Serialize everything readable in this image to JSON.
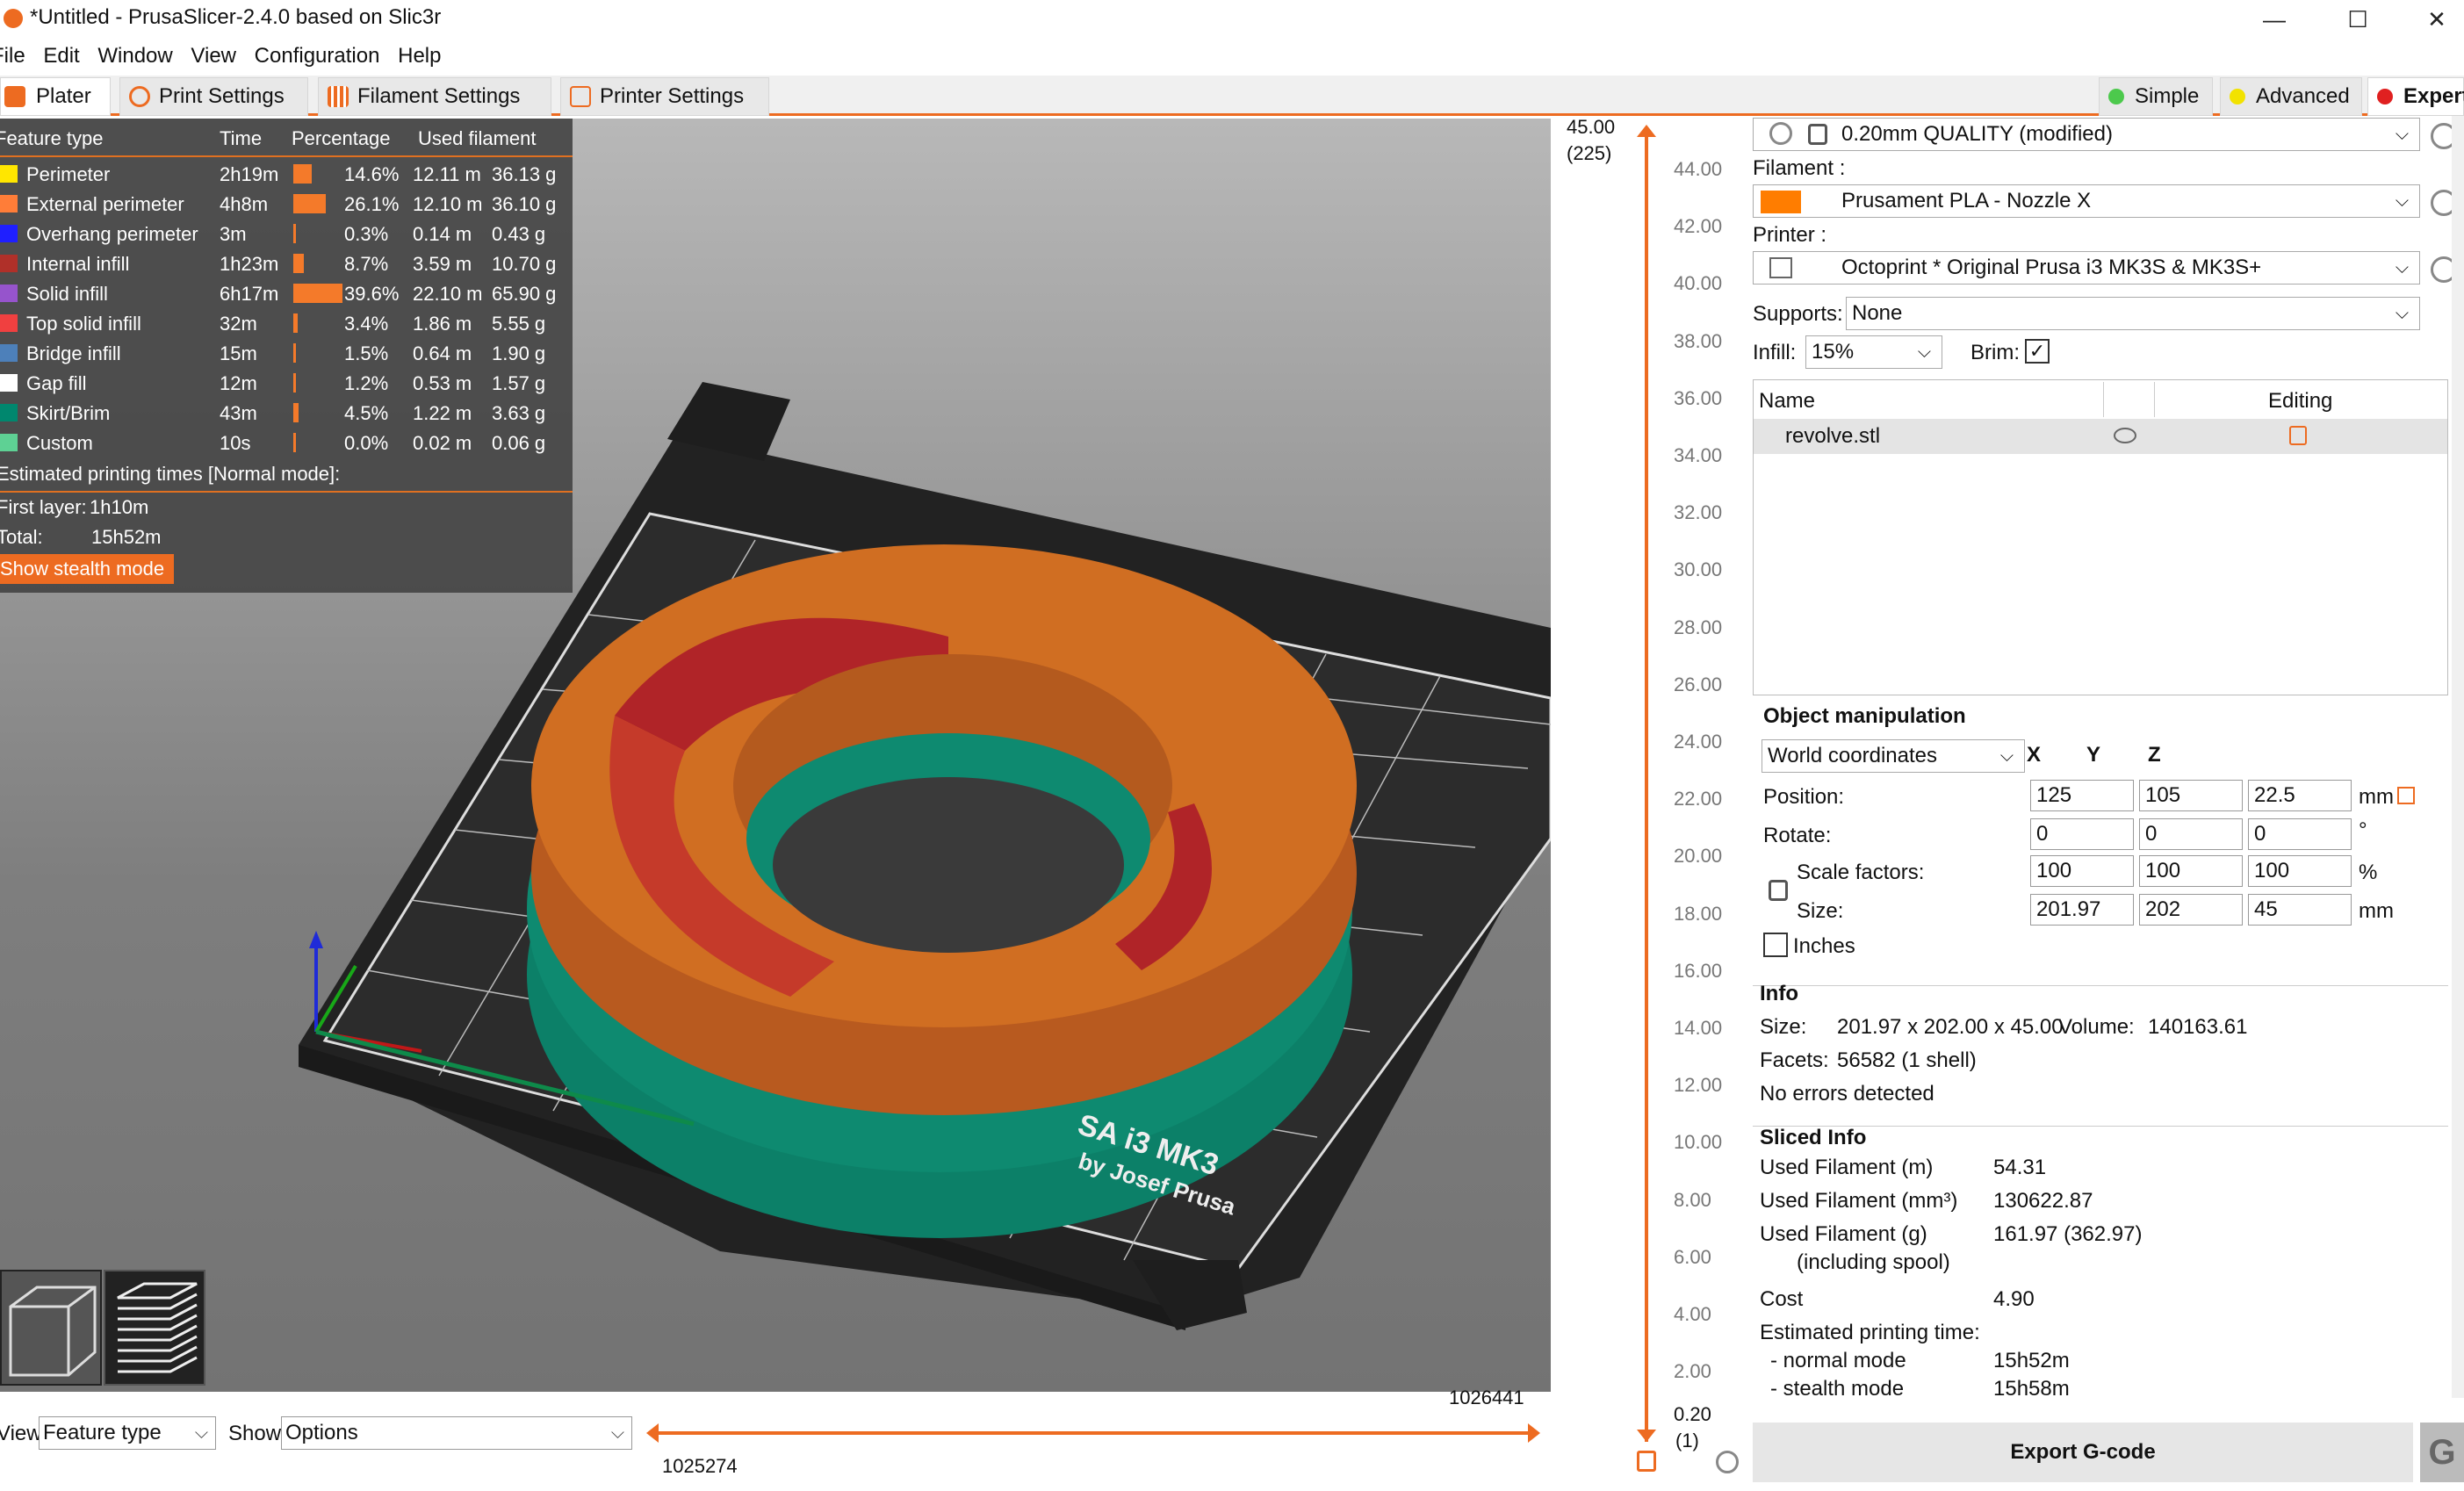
{
  "window": {
    "title": "*Untitled - PrusaSlicer-2.4.0 based on Slic3r",
    "minimize": "—",
    "maximize": "☐",
    "close": "✕"
  },
  "menu": [
    "File",
    "Edit",
    "Window",
    "View",
    "Configuration",
    "Help"
  ],
  "tabs": [
    "Plater",
    "Print Settings",
    "Filament Settings",
    "Printer Settings"
  ],
  "modes": [
    "Simple",
    "Advanced",
    "Expert"
  ],
  "legend": {
    "headers": [
      "Feature type",
      "Time",
      "Percentage",
      "Used filament"
    ],
    "rows": [
      {
        "name": "Perimeter",
        "time": "2h19m",
        "pct": "14.6%",
        "pct_value": 14.6,
        "len": "12.11 m",
        "weight": "36.13 g",
        "color": "#FFE600"
      },
      {
        "name": "External perimeter",
        "time": "4h8m",
        "pct": "26.1%",
        "pct_value": 26.1,
        "len": "12.10 m",
        "weight": "36.10 g",
        "color": "#FF7D38"
      },
      {
        "name": "Overhang perimeter",
        "time": "3m",
        "pct": "0.3%",
        "pct_value": 0.3,
        "len": "0.14 m",
        "weight": "0.43 g",
        "color": "#1F1FFF"
      },
      {
        "name": "Internal infill",
        "time": "1h23m",
        "pct": "8.7%",
        "pct_value": 8.7,
        "len": "3.59 m",
        "weight": "10.70 g",
        "color": "#B03029"
      },
      {
        "name": "Solid infill",
        "time": "6h17m",
        "pct": "39.6%",
        "pct_value": 39.6,
        "len": "22.10 m",
        "weight": "65.90 g",
        "color": "#9654CC"
      },
      {
        "name": "Top solid infill",
        "time": "32m",
        "pct": "3.4%",
        "pct_value": 3.4,
        "len": "1.86 m",
        "weight": "5.55 g",
        "color": "#F04040"
      },
      {
        "name": "Bridge infill",
        "time": "15m",
        "pct": "1.5%",
        "pct_value": 1.5,
        "len": "0.64 m",
        "weight": "1.90 g",
        "color": "#4D80BA"
      },
      {
        "name": "Gap fill",
        "time": "12m",
        "pct": "1.2%",
        "pct_value": 1.2,
        "len": "0.53 m",
        "weight": "1.57 g",
        "color": "#FFFFFF"
      },
      {
        "name": "Skirt/Brim",
        "time": "43m",
        "pct": "4.5%",
        "pct_value": 4.5,
        "len": "1.22 m",
        "weight": "3.63 g",
        "color": "#00876E"
      },
      {
        "name": "Custom",
        "time": "10s",
        "pct": "0.0%",
        "pct_value": 0.0,
        "len": "0.02 m",
        "weight": "0.06 g",
        "color": "#5ED194"
      }
    ],
    "estimated_label": "Estimated printing times [Normal mode]:",
    "first_layer_label": "First layer:",
    "first_layer": "1h10m",
    "total_label": "Total:",
    "total": "15h52m",
    "stealth_button": "Show stealth mode"
  },
  "bed_text": {
    "line1": "SA i3 MK3",
    "line2": "by Josef Prusa"
  },
  "bottom": {
    "view_label": "View",
    "view_value": "Feature type",
    "show_label": "Show",
    "show_value": "Options",
    "h_top_value": "1026441",
    "h_bottom_value": "1025274"
  },
  "vslider": {
    "top_value": "45.00",
    "top_layer": "(225)",
    "bottom_value": "0.20",
    "bottom_layer": "(1)",
    "ticks": [
      "44.00",
      "42.00",
      "40.00",
      "38.00",
      "36.00",
      "34.00",
      "32.00",
      "30.00",
      "28.00",
      "26.00",
      "24.00",
      "22.00",
      "20.00",
      "18.00",
      "16.00",
      "14.00",
      "12.00",
      "10.00",
      "8.00",
      "6.00",
      "4.00",
      "2.00"
    ]
  },
  "right": {
    "print_profile": "0.20mm QUALITY (modified)",
    "filament_label": "Filament :",
    "filament_profile": "Prusament PLA - Nozzle X",
    "filament_color": "#FF7D00",
    "printer_label": "Printer :",
    "printer_profile": "Octoprint * Original Prusa i3 MK3S & MK3S+",
    "supports_label": "Supports:",
    "supports_value": "None",
    "infill_label": "Infill:",
    "infill_value": "15%",
    "brim_label": "Brim:",
    "brim_check": "✓",
    "list_name_header": "Name",
    "list_editing_header": "Editing",
    "object_name": "revolve.stl",
    "om_title": "Object manipulation",
    "coords": "World coordinates",
    "axes": [
      "X",
      "Y",
      "Z"
    ],
    "position_label": "Position:",
    "position": [
      "125",
      "105",
      "22.5"
    ],
    "position_unit": "mm",
    "rotate_label": "Rotate:",
    "rotate": [
      "0",
      "0",
      "0"
    ],
    "rotate_unit": "°",
    "scale_label": "Scale factors:",
    "scale": [
      "100",
      "100",
      "100"
    ],
    "scale_unit": "%",
    "size_label": "Size:",
    "size": [
      "201.97",
      "202",
      "45"
    ],
    "size_unit": "mm",
    "inches_label": "Inches",
    "info_title": "Info",
    "info_size_label": "Size:",
    "info_size": "201.97 x 202.00 x 45.00",
    "info_volume_label": "Volume:",
    "info_volume": "140163.61",
    "info_facets_label": "Facets:",
    "info_facets": "56582 (1 shell)",
    "info_errors": "No errors detected",
    "sliced_title": "Sliced Info",
    "sliced": [
      {
        "label": "Used Filament (m)",
        "value": "54.31"
      },
      {
        "label": "Used Filament (mm³)",
        "value": "130622.87"
      },
      {
        "label": "Used Filament (g)",
        "value": "161.97 (362.97)"
      },
      {
        "label": "(including spool)",
        "value": ""
      },
      {
        "label": "Cost",
        "value": "4.90"
      },
      {
        "label": "Estimated printing time:",
        "value": ""
      },
      {
        "label": "- normal mode",
        "value": "15h52m"
      },
      {
        "label": "- stealth mode",
        "value": "15h58m"
      }
    ],
    "export_button": "Export G-code"
  }
}
